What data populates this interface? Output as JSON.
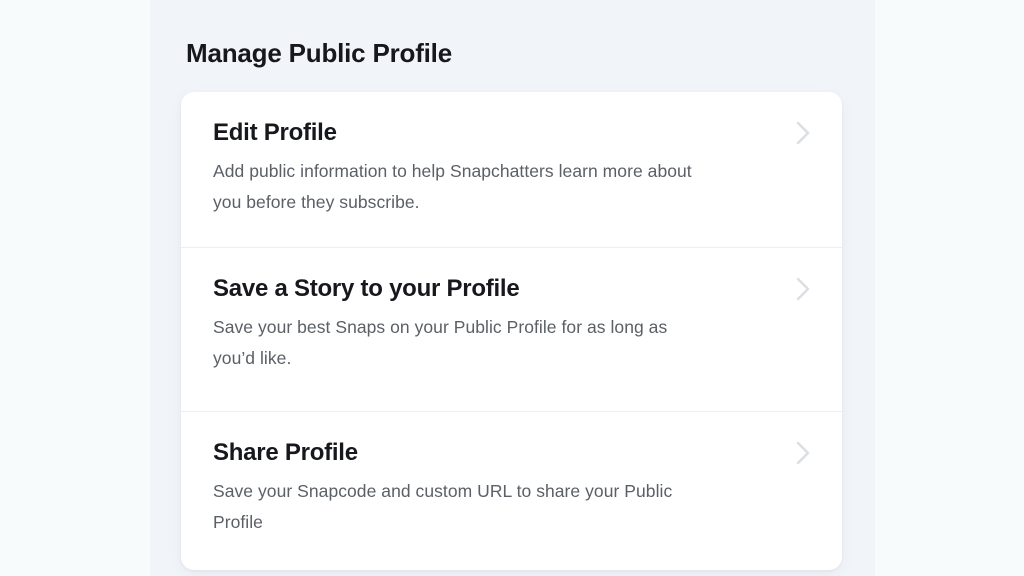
{
  "page": {
    "title": "Manage Public Profile",
    "background_color": "#f1f5f9",
    "outer_background_color": "#f8fbfc",
    "card_background_color": "#ffffff",
    "title_color": "#16181d",
    "description_color": "#5b6066",
    "divider_color": "#eceef0",
    "chevron_color": "#dcdfe3"
  },
  "list": {
    "items": [
      {
        "title": "Edit Profile",
        "description": "Add public information to help Snapchatters learn more about you before they subscribe.",
        "chevron": "chevron-right-icon"
      },
      {
        "title": "Save a Story to your Profile",
        "description": "Save your best Snaps on your Public Profile for as long as you’d like.",
        "chevron": "chevron-right-icon"
      },
      {
        "title": "Share Profile",
        "description": "Save your Snapcode and custom URL to share your Public Profile",
        "chevron": "chevron-right-icon"
      }
    ]
  }
}
